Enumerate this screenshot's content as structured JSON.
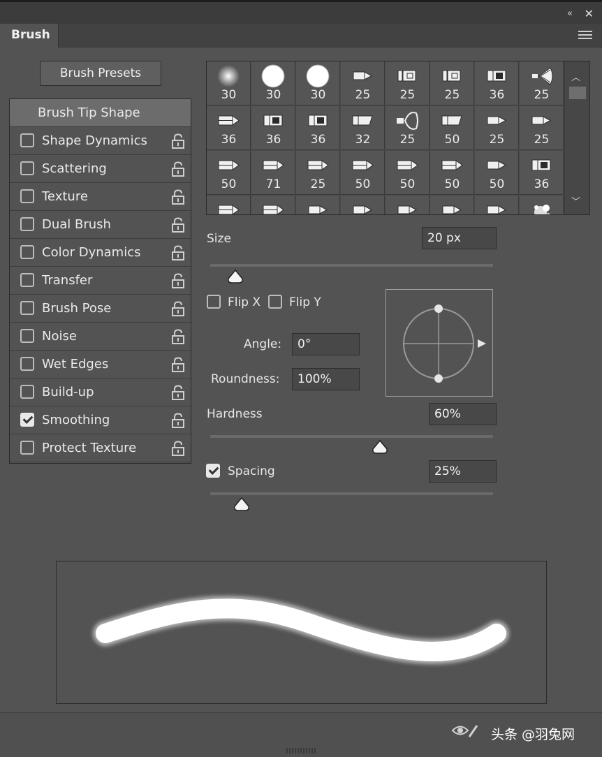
{
  "panel": {
    "tab_title": "Brush",
    "collapse_glyph": "«",
    "close_glyph": "✕",
    "presets_button": "Brush Presets"
  },
  "settings": [
    {
      "label": "Brush Tip Shape",
      "selected": true,
      "has_checkbox": false
    },
    {
      "label": "Shape Dynamics",
      "checked": false
    },
    {
      "label": "Scattering",
      "checked": false
    },
    {
      "label": "Texture",
      "checked": false
    },
    {
      "label": "Dual Brush",
      "checked": false
    },
    {
      "label": "Color Dynamics",
      "checked": false
    },
    {
      "label": "Transfer",
      "checked": false
    },
    {
      "label": "Brush Pose",
      "checked": false
    },
    {
      "label": "Noise",
      "checked": false
    },
    {
      "label": "Wet Edges",
      "checked": false
    },
    {
      "label": "Build-up",
      "checked": false
    },
    {
      "label": "Smoothing",
      "checked": true
    },
    {
      "label": "Protect Texture",
      "checked": false
    }
  ],
  "brush_tips": [
    [
      "30",
      "30",
      "30",
      "25",
      "25",
      "25",
      "36",
      "25"
    ],
    [
      "36",
      "36",
      "36",
      "32",
      "25",
      "50",
      "25",
      "25"
    ],
    [
      "50",
      "71",
      "25",
      "50",
      "50",
      "50",
      "50",
      "36"
    ],
    [
      "",
      "",
      "",
      "",
      "",
      "",
      "",
      ""
    ]
  ],
  "brush_tip_icons": [
    [
      "soft-round-brush-icon",
      "hard-round-brush-icon",
      "hard-round-brush-icon",
      "marker-tip-icon",
      "chisel-tip-icon",
      "chisel-tip-icon",
      "flat-tip-icon",
      "fan-brush-icon"
    ],
    [
      "pencil-tip-icon",
      "flat-tip-icon",
      "flat-tip-icon",
      "angled-tip-icon",
      "spray-tip-icon",
      "angled-tip-icon",
      "marker-tip-icon",
      "marker-tip-icon"
    ],
    [
      "pencil-tip-icon",
      "pencil-tip-icon",
      "pencil-tip-icon",
      "pencil-tip-icon",
      "pencil-tip-icon",
      "pencil-tip-icon",
      "marker-tip-icon",
      "flat-tip-icon"
    ],
    [
      "pencil-tip-icon",
      "pencil-tip-icon",
      "marker-tip-icon",
      "marker-tip-icon",
      "marker-tip-icon",
      "marker-tip-icon",
      "marker-tip-icon",
      "splatter-brush-icon"
    ]
  ],
  "size": {
    "label": "Size",
    "value": "20 px",
    "slider_fraction": 0.09
  },
  "flip_x": {
    "label": "Flip X",
    "checked": false
  },
  "flip_y": {
    "label": "Flip Y",
    "checked": false
  },
  "angle": {
    "label": "Angle:",
    "value": "0°"
  },
  "roundness": {
    "label": "Roundness:",
    "value": "100%"
  },
  "hardness": {
    "label": "Hardness",
    "value": "60%",
    "slider_fraction": 0.6
  },
  "spacing": {
    "label": "Spacing",
    "value": "25%",
    "checked": true,
    "slider_fraction": 0.11
  },
  "footer": {
    "watermark": "头条 @羽兔网"
  }
}
